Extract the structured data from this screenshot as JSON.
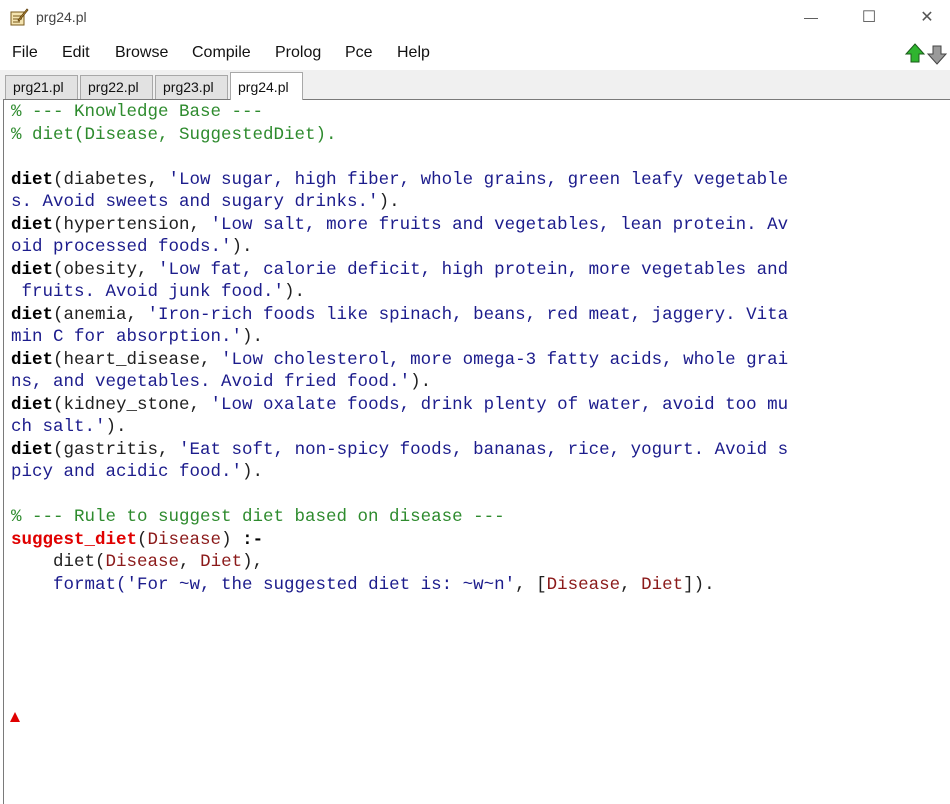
{
  "window": {
    "title": "prg24.pl",
    "minimize_glyph": "—",
    "maximize_glyph": "☐",
    "close_glyph": "✕"
  },
  "menu": [
    "File",
    "Edit",
    "Browse",
    "Compile",
    "Prolog",
    "Pce",
    "Help"
  ],
  "tabs": [
    {
      "label": "prg21.pl",
      "active": false
    },
    {
      "label": "prg22.pl",
      "active": false
    },
    {
      "label": "prg23.pl",
      "active": false
    },
    {
      "label": "prg24.pl",
      "active": true
    }
  ],
  "icons": {
    "app": "quill-edit-icon",
    "nav_up": "green-up-arrow-icon",
    "nav_down": "gray-down-arrow-icon"
  },
  "colors": {
    "comment": "#2e8b2e",
    "string": "#1c1c8c",
    "variable": "#8b1a1a",
    "rule_head": "#e00000"
  },
  "code": {
    "comment1": "% --- Knowledge Base ---",
    "comment2": "% diet(Disease, SuggestedDiet).",
    "facts": [
      {
        "head": "diet",
        "pre": "(diabetes, ",
        "str": "'Low sugar, high fiber, whole grains, green leafy vegetable\ns. Avoid sweets and sugary drinks.'",
        "post": ")."
      },
      {
        "head": "diet",
        "pre": "(hypertension, ",
        "str": "'Low salt, more fruits and vegetables, lean protein. Av\noid processed foods.'",
        "post": ")."
      },
      {
        "head": "diet",
        "pre": "(obesity, ",
        "str": "'Low fat, calorie deficit, high protein, more vegetables and\n fruits. Avoid junk food.'",
        "post": ")."
      },
      {
        "head": "diet",
        "pre": "(anemia, ",
        "str": "'Iron-rich foods like spinach, beans, red meat, jaggery. Vita\nmin C for absorption.'",
        "post": ")."
      },
      {
        "head": "diet",
        "pre": "(heart_disease, ",
        "str": "'Low cholesterol, more omega-3 fatty acids, whole grai\nns, and vegetables. Avoid fried food.'",
        "post": ")."
      },
      {
        "head": "diet",
        "pre": "(kidney_stone, ",
        "str": "'Low oxalate foods, drink plenty of water, avoid too mu\nch salt.'",
        "post": ")."
      },
      {
        "head": "diet",
        "pre": "(gastritis, ",
        "str": "'Eat soft, non-spicy foods, bananas, rice, yogurt. Avoid s\npicy and acidic food.'",
        "post": ")."
      }
    ],
    "comment3": "% --- Rule to suggest diet based on disease ---",
    "rule": {
      "head": "suggest_diet",
      "open": "(",
      "arg": "Disease",
      "close": ") ",
      "neck": ":-",
      "goal1_indent": "    ",
      "goal1_name": "diet(",
      "goal1_arg1": "Disease",
      "goal1_sep": ", ",
      "goal1_arg2": "Diet",
      "goal1_end": "),",
      "goal2_indent": "    ",
      "goal2_name": "format(",
      "goal2_str": "'For ~w, the suggested diet is: ~w~n'",
      "goal2_mid": ", [",
      "goal2_arg1": "Disease",
      "goal2_sep": ", ",
      "goal2_arg2": "Diet",
      "goal2_end": "])."
    }
  }
}
